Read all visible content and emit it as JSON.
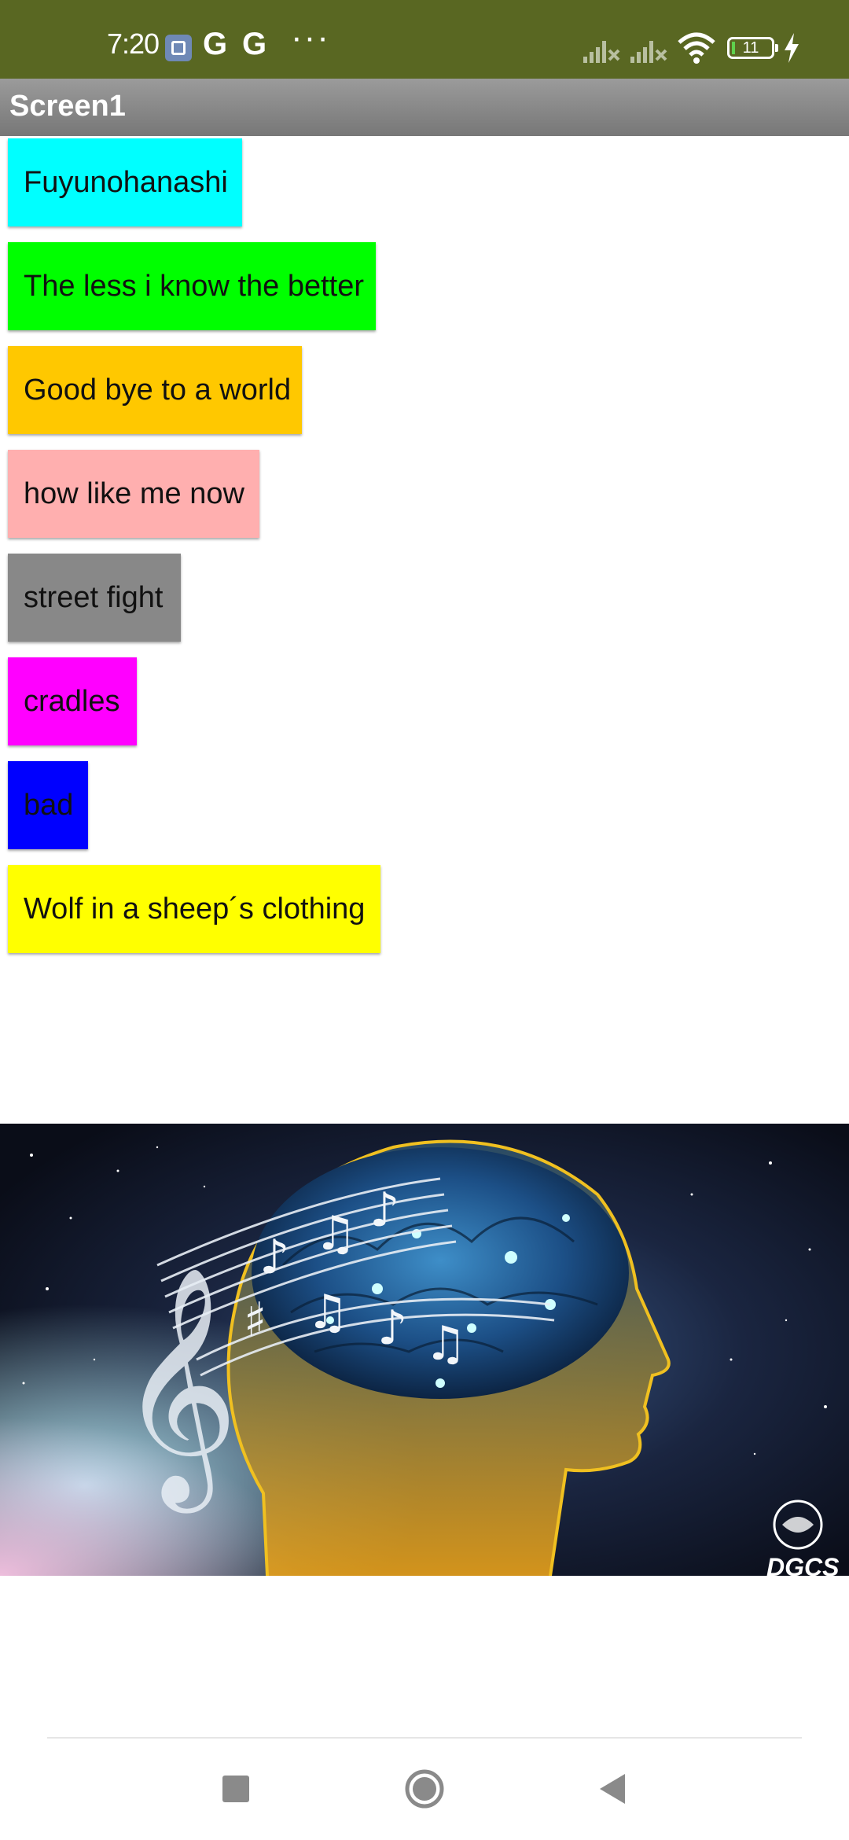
{
  "status_bar": {
    "time": "7:20",
    "battery_level": "11",
    "icons": [
      "photo-app-icon",
      "google-icon",
      "google-icon",
      "more-dots-icon",
      "signal-off-icon",
      "signal-off-icon",
      "wifi-icon",
      "battery-icon",
      "charging-icon"
    ],
    "background_color": "#596722"
  },
  "title_bar": {
    "title": "Screen1"
  },
  "songs": [
    {
      "label": "Fuyunohanashi",
      "color": "#00ffff"
    },
    {
      "label": "The less i know the better",
      "color": "#00ff00"
    },
    {
      "label": "Good bye to a world",
      "color": "#ffc800"
    },
    {
      "label": "how like me now",
      "color": "#ffafaf"
    },
    {
      "label": "street fight",
      "color": "#888888"
    },
    {
      "label": "cradles",
      "color": "#ff00ff"
    },
    {
      "label": "bad",
      "color": "#0000ff"
    },
    {
      "label": "Wolf in a sheep´s clothing",
      "color": "#ffff00"
    }
  ],
  "hero_image": {
    "description_icon": "brain-music-image",
    "watermark": "DGCS"
  },
  "nav_bar": {
    "buttons": [
      "recents-square-icon",
      "home-circle-icon",
      "back-triangle-icon"
    ]
  }
}
